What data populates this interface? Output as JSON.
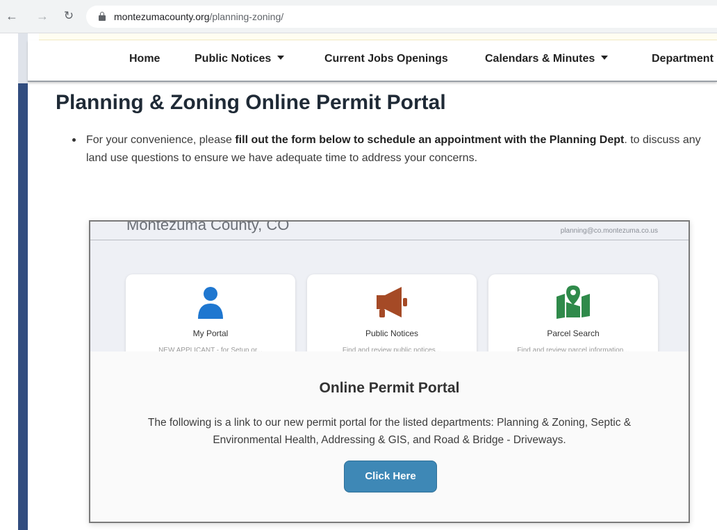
{
  "browser": {
    "url_domain": "montezumacounty.org",
    "url_path": "/planning-zoning/"
  },
  "nav": {
    "items": [
      {
        "label": "Home",
        "has_dropdown": false
      },
      {
        "label": "Public Notices",
        "has_dropdown": true
      },
      {
        "label": "Current Jobs Openings",
        "has_dropdown": false
      },
      {
        "label": "Calendars & Minutes",
        "has_dropdown": true
      },
      {
        "label": "Department",
        "has_dropdown": false
      }
    ]
  },
  "main": {
    "title": "Planning & Zoning Online Permit Portal",
    "intro_prefix": "For your convenience, please ",
    "intro_bold": "fill out the form below to schedule an appointment with the Planning Dept",
    "intro_suffix": ". to discuss any land use questions to ensure we have adequate time to address your concerns."
  },
  "embed": {
    "org": "Montezuma County, CO",
    "email": "planning@co.montezuma.co.us",
    "cards": [
      {
        "label": "My Portal",
        "sub": "NEW APPLICANT - for Setup or...",
        "icon": "person-icon"
      },
      {
        "label": "Public Notices",
        "sub": "Find and review public notices...",
        "icon": "megaphone-icon"
      },
      {
        "label": "Parcel Search",
        "sub": "Find and review parcel information...",
        "icon": "map-pin-icon"
      }
    ],
    "overlay_title": "Online Permit Portal",
    "overlay_text": "The following is a link to our new permit portal for the listed departments: Planning & Zoning, Septic & Environmental Health, Addressing & GIS, and Road & Bridge - Driveways.",
    "button_label": "Click Here"
  },
  "colors": {
    "left_bar": "#324d7f",
    "button": "#3e88b6",
    "person_icon": "#1f77d0",
    "megaphone_icon": "#a54a26",
    "map_icon": "#2f8a4a"
  }
}
